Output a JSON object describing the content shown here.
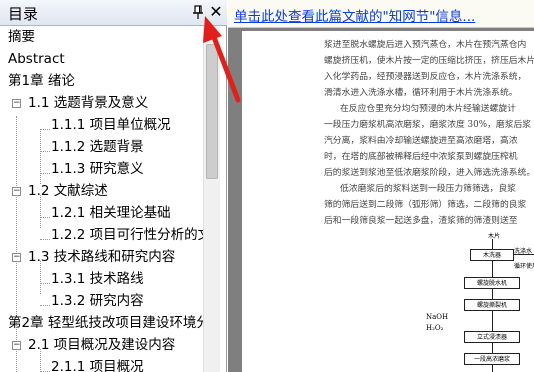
{
  "outline": {
    "title": "目录",
    "items": [
      {
        "label": "摘要"
      },
      {
        "label": "Abstract"
      },
      {
        "label": "第1章 绪论"
      },
      {
        "label": "1.1 选题背景及意义"
      },
      {
        "label": "1.1.1 项目单位概况"
      },
      {
        "label": "1.1.2 选题背景"
      },
      {
        "label": "1.1.3 研究意义"
      },
      {
        "label": "1.2 文献综述"
      },
      {
        "label": "1.2.1 相关理论基础"
      },
      {
        "label": "1.2.2 项目可行性分析的文"
      },
      {
        "label": "1.3 技术路线和研究内容"
      },
      {
        "label": "1.3.1 技术路线"
      },
      {
        "label": "1.3.2 研究内容"
      },
      {
        "label": "第2章 轻型纸技改项目建设环境分"
      },
      {
        "label": "2.1 项目概况及建设内容"
      },
      {
        "label": "2.1.1 项目概况"
      }
    ]
  },
  "document": {
    "link_text": "单击此处查看此篇文献的\"知网节\"信息...",
    "paragraphs": [
      "浆进至脱水螺旋后进入预汽蒸仓，木片在预汽蒸仓内",
      "螺旋挤压机，使木片按一定的压缩比挤压，挤压后木片",
      "入化学药品，经预浸器送到反应仓，木片洗涤系统，",
      "滑清水进入洗涤水槽，循环利用于木片洗涤系统。",
      "在反应仓里充分均匀预浸的木片经输送螺旋计",
      "一段压力磨浆机高浓磨浆，磨浆浓度 30%，磨浆后浆",
      "汽分离，浆料由冷却输送螺旋进至高浓磨塔，高浓",
      "时，在塔的底部被稀释后经中浓浆泵到螺旋压榨机",
      "后的浆送到浆池至低浓磨浆阶段，进入筛选洗涤系统。",
      "低浓磨浆后的浆料送到一段压力筛筛选，良浆",
      "筛的筛后送到二段筛（弧形筛）筛选，二段筛的良浆",
      "后和一段筛良浆一起送多盘，渣浆筛的筛渣则送至"
    ],
    "flow": {
      "top_label": "木片",
      "right_label_1": "洗涤水",
      "right_label_2": "循环使用",
      "side_label_1": "NaOH",
      "side_label_2": "H₂O₂",
      "steps": [
        "木洗器",
        "螺旋脱水机",
        "螺旋撕裂机",
        "立式浸渍器",
        "一段高浓磨浆"
      ]
    }
  },
  "colors": {
    "link": "#0b3cdb",
    "annotation_arrow": "#e0201b",
    "pane_border": "#9a9a9a"
  },
  "icons": [
    "pin-icon",
    "close-icon",
    "scroll-up-icon"
  ]
}
